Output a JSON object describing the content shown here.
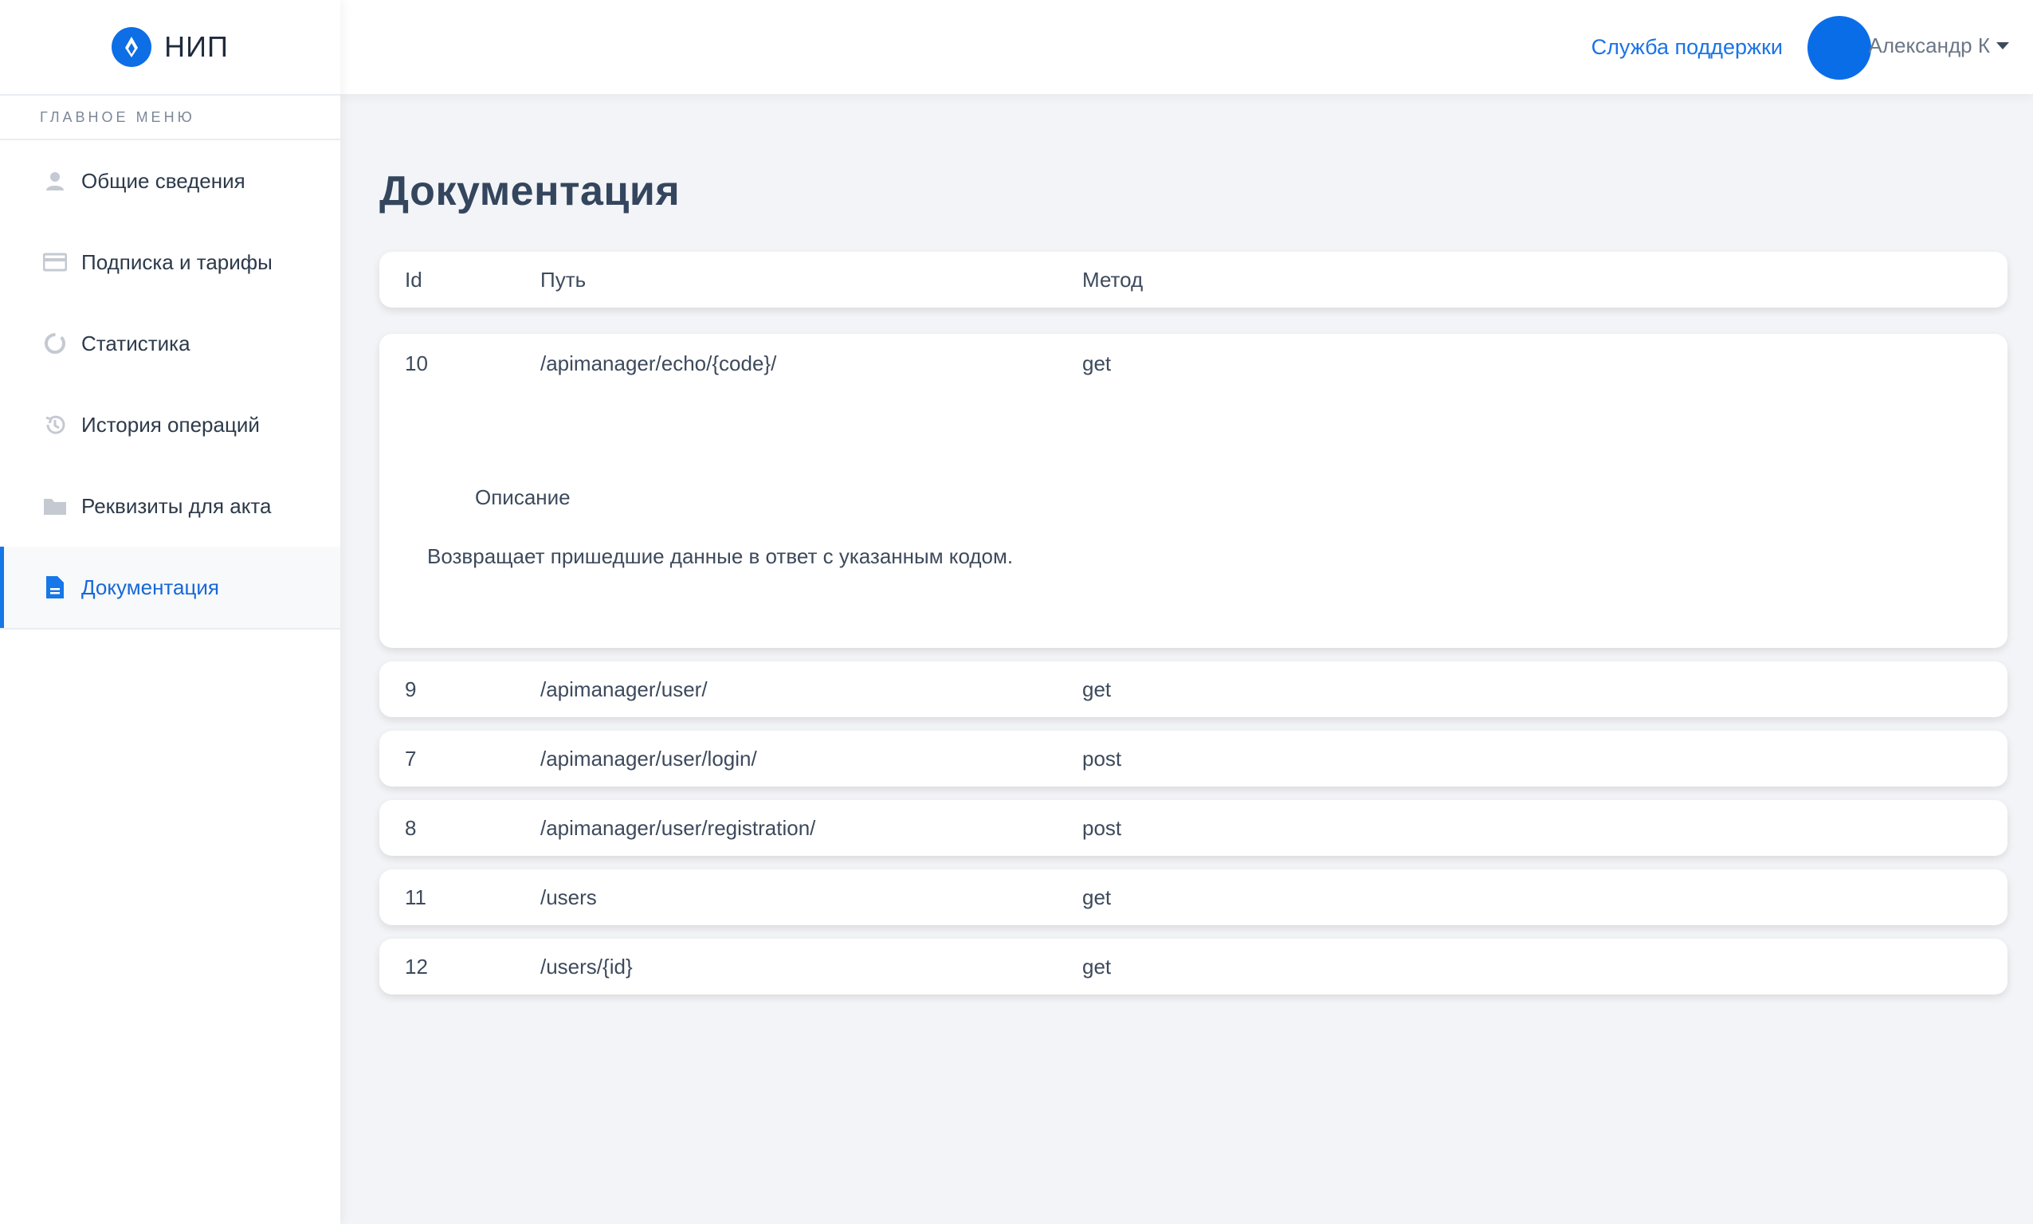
{
  "brand": {
    "name": "НИП",
    "logo_icon": "flame-logo-icon",
    "logo_color": "#0d6ee6"
  },
  "sidebar": {
    "header": "Главное меню",
    "items": [
      {
        "label": "Общие сведения",
        "icon": "user-icon",
        "active": false
      },
      {
        "label": "Подписка и тарифы",
        "icon": "credit-card-icon",
        "active": false
      },
      {
        "label": "Статистика",
        "icon": "chart-ring-icon",
        "active": false
      },
      {
        "label": "История операций",
        "icon": "history-icon",
        "active": false
      },
      {
        "label": "Реквизиты для акта",
        "icon": "folder-icon",
        "active": false
      },
      {
        "label": "Документация",
        "icon": "document-icon",
        "active": true
      }
    ]
  },
  "topbar": {
    "support_link": "Служба поддержки",
    "user_name": "Александр К",
    "accent_color": "#1a73e8"
  },
  "page": {
    "title": "Документация",
    "table": {
      "headers": {
        "id": "Id",
        "path": "Путь",
        "method": "Метод"
      },
      "expanded": {
        "id": "10",
        "path": "/apimanager/echo/{code}/",
        "method": "get",
        "description_label": "Описание",
        "description_text": "Возвращает пришедшие данные в ответ с указанным кодом."
      },
      "rows": [
        {
          "id": "9",
          "path": "/apimanager/user/",
          "method": "get"
        },
        {
          "id": "7",
          "path": "/apimanager/user/login/",
          "method": "post"
        },
        {
          "id": "8",
          "path": "/apimanager/user/registration/",
          "method": "post"
        },
        {
          "id": "11",
          "path": "/users",
          "method": "get"
        },
        {
          "id": "12",
          "path": "/users/{id}",
          "method": "get"
        }
      ]
    }
  }
}
